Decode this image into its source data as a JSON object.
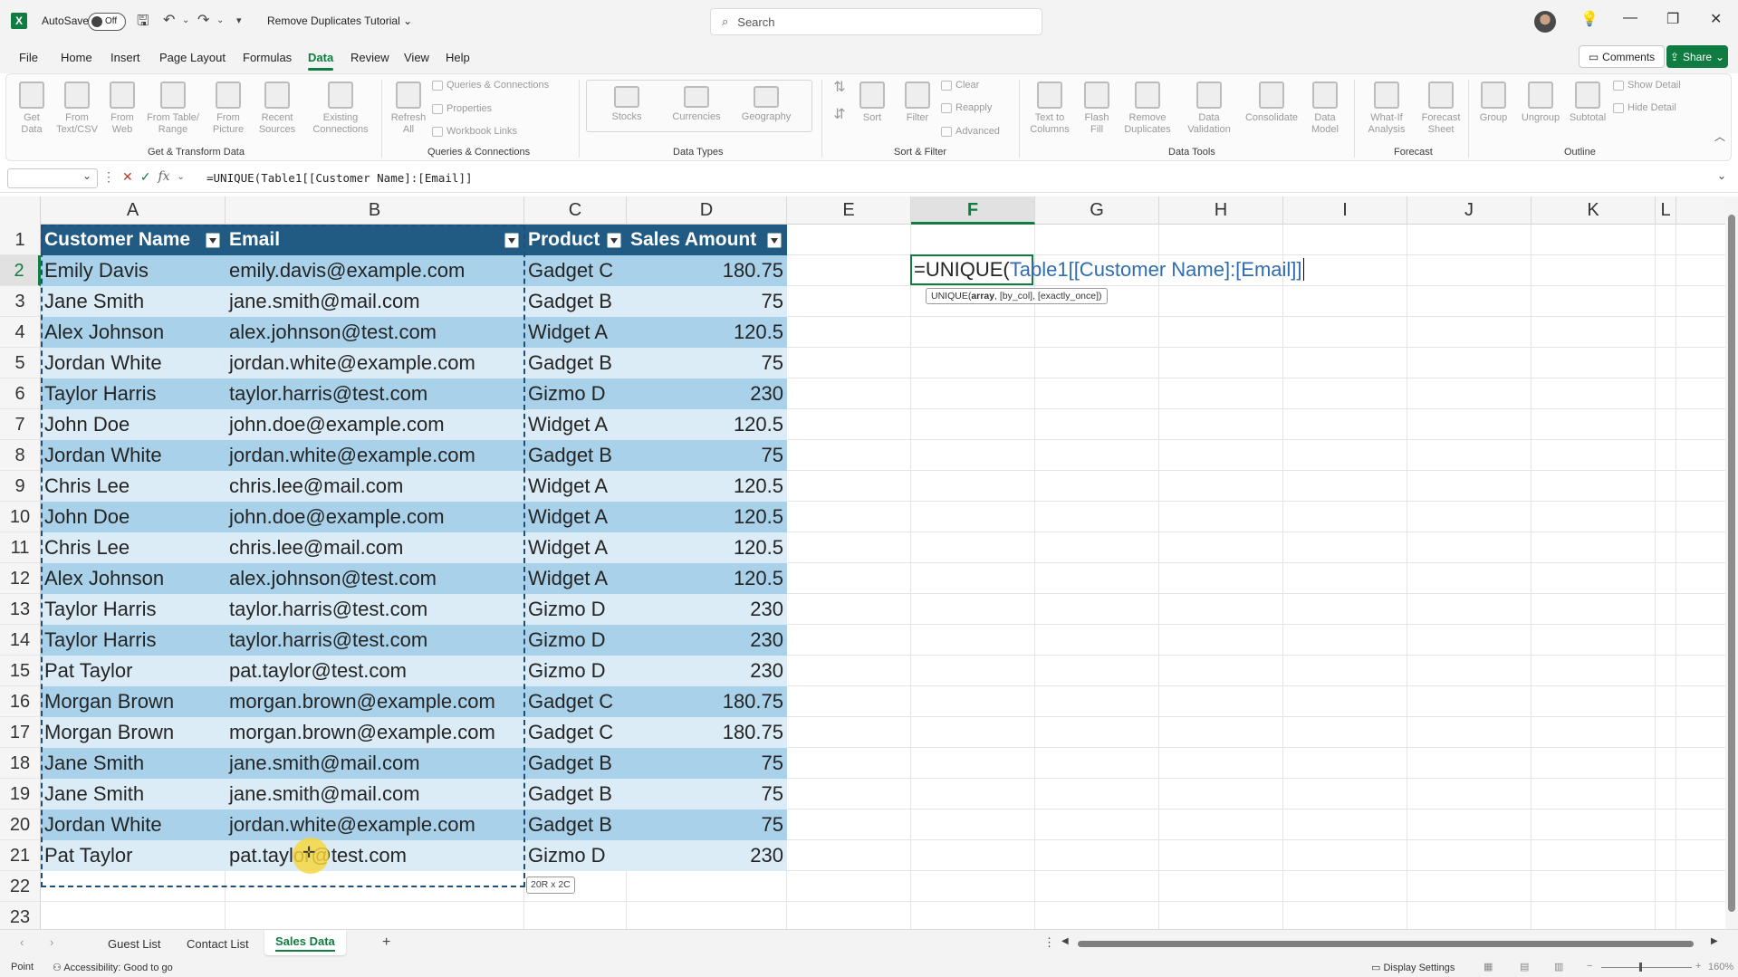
{
  "titlebar": {
    "autosave_label": "AutoSave",
    "autosave_state": "Off",
    "doc_title": "Remove Duplicates Tutorial",
    "search_placeholder": "Search"
  },
  "menu": {
    "tabs": [
      "File",
      "Home",
      "Insert",
      "Page Layout",
      "Formulas",
      "Data",
      "Review",
      "View",
      "Help"
    ],
    "active_tab": "Data",
    "comments_label": "Comments",
    "share_label": "Share"
  },
  "ribbon": {
    "get_transform": {
      "label": "Get & Transform Data",
      "buttons": [
        "Get Data",
        "From Text/CSV",
        "From Web",
        "From Table/ Range",
        "From Picture",
        "Recent Sources",
        "Existing Connections"
      ]
    },
    "queries": {
      "label": "Queries & Connections",
      "refresh": "Refresh All",
      "items": [
        "Queries & Connections",
        "Properties",
        "Workbook Links"
      ]
    },
    "data_types": {
      "label": "Data Types",
      "items": [
        "Stocks",
        "Currencies",
        "Geography"
      ]
    },
    "sort_filter": {
      "label": "Sort & Filter",
      "sort": "Sort",
      "filter": "Filter",
      "small": [
        "Clear",
        "Reapply",
        "Advanced"
      ]
    },
    "data_tools": {
      "label": "Data Tools",
      "buttons": [
        "Text to Columns",
        "Flash Fill",
        "Remove Duplicates",
        "Data Validation",
        "Consolidate",
        "Data Model"
      ]
    },
    "forecast": {
      "label": "Forecast",
      "buttons": [
        "What-If Analysis",
        "Forecast Sheet"
      ]
    },
    "outline": {
      "label": "Outline",
      "buttons": [
        "Group",
        "Ungroup",
        "Subtotal"
      ],
      "small": [
        "Show Detail",
        "Hide Detail"
      ]
    }
  },
  "formula_bar": {
    "name_box": "",
    "formula": "=UNIQUE(Table1[[Customer Name]:[Email]]"
  },
  "grid": {
    "columns": [
      "A",
      "B",
      "C",
      "D",
      "E",
      "F",
      "G",
      "H",
      "I",
      "J",
      "K",
      "L"
    ],
    "selected_column": "F",
    "selected_row": "2",
    "rows": [
      "1",
      "2",
      "3",
      "4",
      "5",
      "6",
      "7",
      "8",
      "9",
      "10",
      "11",
      "12",
      "13",
      "14",
      "15",
      "16",
      "17",
      "18",
      "19",
      "20",
      "21",
      "22",
      "23"
    ],
    "table": {
      "headers": [
        "Customer Name",
        "Email",
        "Product",
        "Sales Amount"
      ],
      "data": [
        [
          "Emily Davis",
          "emily.davis@example.com",
          "Gadget C",
          "180.75"
        ],
        [
          "Jane Smith",
          "jane.smith@mail.com",
          "Gadget B",
          "75"
        ],
        [
          "Alex Johnson",
          "alex.johnson@test.com",
          "Widget A",
          "120.5"
        ],
        [
          "Jordan White",
          "jordan.white@example.com",
          "Gadget B",
          "75"
        ],
        [
          "Taylor Harris",
          "taylor.harris@test.com",
          "Gizmo D",
          "230"
        ],
        [
          "John Doe",
          "john.doe@example.com",
          "Widget A",
          "120.5"
        ],
        [
          "Jordan White",
          "jordan.white@example.com",
          "Gadget B",
          "75"
        ],
        [
          "Chris Lee",
          "chris.lee@mail.com",
          "Widget A",
          "120.5"
        ],
        [
          "John Doe",
          "john.doe@example.com",
          "Widget A",
          "120.5"
        ],
        [
          "Chris Lee",
          "chris.lee@mail.com",
          "Widget A",
          "120.5"
        ],
        [
          "Alex Johnson",
          "alex.johnson@test.com",
          "Widget A",
          "120.5"
        ],
        [
          "Taylor Harris",
          "taylor.harris@test.com",
          "Gizmo D",
          "230"
        ],
        [
          "Taylor Harris",
          "taylor.harris@test.com",
          "Gizmo D",
          "230"
        ],
        [
          "Pat Taylor",
          "pat.taylor@test.com",
          "Gizmo D",
          "230"
        ],
        [
          "Morgan Brown",
          "morgan.brown@example.com",
          "Gadget C",
          "180.75"
        ],
        [
          "Morgan Brown",
          "morgan.brown@example.com",
          "Gadget C",
          "180.75"
        ],
        [
          "Jane Smith",
          "jane.smith@mail.com",
          "Gadget B",
          "75"
        ],
        [
          "Jane Smith",
          "jane.smith@mail.com",
          "Gadget B",
          "75"
        ],
        [
          "Jordan White",
          "jordan.white@example.com",
          "Gadget B",
          "75"
        ],
        [
          "Pat Taylor",
          "pat.taylor@test.com",
          "Gizmo D",
          "230"
        ]
      ]
    },
    "editing": {
      "func": "=UNIQUE(",
      "ref": "Table1[[Customer Name]:[Email]]"
    },
    "tooltip": {
      "func": "UNIQUE(",
      "arg1": "array",
      ", rest": "",
      "rest": ", [by_col], [exactly_once])"
    },
    "size_tip": "20R x 2C"
  },
  "sheets": {
    "tabs": [
      "Guest List",
      "Contact List",
      "Sales Data"
    ],
    "active": "Sales Data",
    "add_label": "+"
  },
  "status": {
    "mode": "Point",
    "accessibility": "Accessibility: Good to go",
    "display_settings": "Display Settings",
    "zoom": "160%"
  },
  "colors": {
    "accent": "#107c41",
    "table_header": "#215b83",
    "band_dark": "#a9d2ea",
    "band_light": "#dcecf6",
    "ref_blue": "#2f6db0"
  }
}
